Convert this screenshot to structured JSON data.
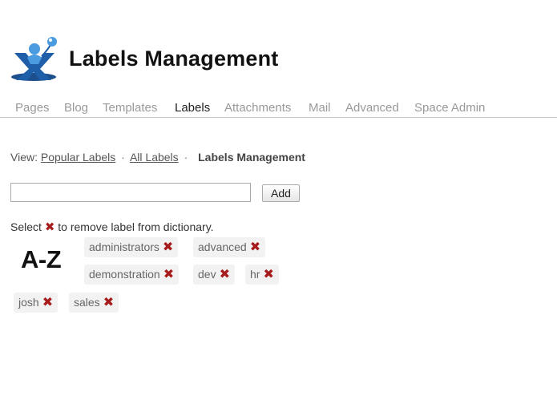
{
  "header": {
    "title": "Labels Management",
    "logo_icon": "xwiki-logo-icon"
  },
  "tabs": [
    {
      "label": "Pages",
      "active": false
    },
    {
      "label": "Blog",
      "active": false
    },
    {
      "label": "Templates",
      "active": false
    },
    {
      "label": "Labels",
      "active": true
    },
    {
      "label": "Attachments",
      "active": false
    },
    {
      "label": "Mail",
      "active": false
    },
    {
      "label": "Advanced",
      "active": false
    },
    {
      "label": "Space Admin",
      "active": false
    }
  ],
  "view": {
    "prefix": "View:",
    "popular_labels": "Popular Labels",
    "separator": "·",
    "all_labels": "All Labels",
    "current": "Labels Management"
  },
  "form": {
    "input_value": "",
    "add_label": "Add"
  },
  "instructions": {
    "before": "Select",
    "after": "to remove label from dictionary."
  },
  "remove_mark": "✖",
  "index_heading": "A-Z",
  "labels": [
    {
      "name": "administrators"
    },
    {
      "name": "advanced"
    },
    {
      "name": "demonstration"
    },
    {
      "name": "dev"
    },
    {
      "name": "hr"
    },
    {
      "name": "josh"
    },
    {
      "name": "sales"
    }
  ],
  "colors": {
    "remove_icon": "#a61c1c",
    "tab_inactive": "#999999",
    "tab_active": "#222222",
    "chip_background": "#f2f2f2"
  }
}
